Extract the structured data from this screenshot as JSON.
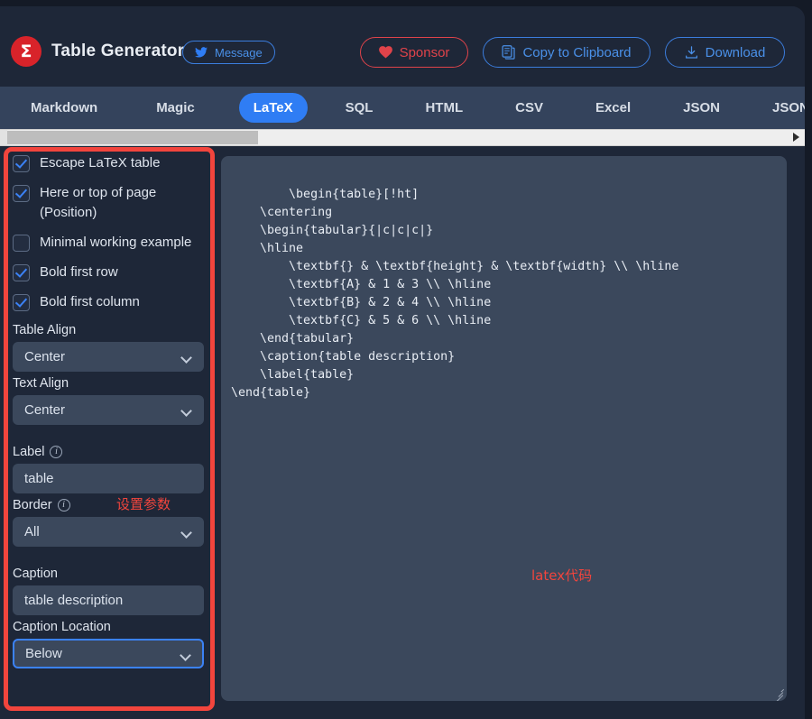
{
  "header": {
    "logo_glyph": "Σ",
    "title": "Table Generator",
    "message_button": "Message",
    "sponsor_button": "Sponsor",
    "copy_button": "Copy to Clipboard",
    "download_button": "Download",
    "colors": {
      "accent_blue": "#2f7df4",
      "accent_red": "#e0434a",
      "logo_red": "#d8232a"
    }
  },
  "tabs": {
    "active": "LaTeX",
    "items": [
      {
        "label": "Markdown"
      },
      {
        "label": "Magic"
      },
      {
        "label": "LaTeX"
      },
      {
        "label": "SQL"
      },
      {
        "label": "HTML"
      },
      {
        "label": "CSV"
      },
      {
        "label": "Excel"
      },
      {
        "label": "JSON"
      },
      {
        "label": "JSONLines"
      }
    ]
  },
  "sidebar": {
    "checkboxes": [
      {
        "label": "Escape LaTeX table",
        "checked": true
      },
      {
        "label": "Here or top of page (Position)",
        "checked": true
      },
      {
        "label": "Minimal working example",
        "checked": false
      },
      {
        "label": "Bold first row",
        "checked": true
      },
      {
        "label": "Bold first column",
        "checked": true
      }
    ],
    "fields": [
      {
        "label": "Table Align",
        "value": "Center",
        "type": "select",
        "focused": false,
        "info": false
      },
      {
        "label": "Text Align",
        "value": "Center",
        "type": "select",
        "focused": false,
        "info": false
      },
      {
        "label": "Label",
        "value": "table",
        "type": "text",
        "focused": false,
        "info": true
      },
      {
        "label": "Border",
        "value": "All",
        "type": "select",
        "focused": false,
        "info": true
      },
      {
        "label": "Caption",
        "value": "table description",
        "type": "text",
        "focused": false,
        "info": false
      },
      {
        "label": "Caption Location",
        "value": "Below",
        "type": "select",
        "focused": true,
        "info": false
      }
    ]
  },
  "code_panel": {
    "content": "\\begin{table}[!ht]\n    \\centering\n    \\begin{tabular}{|c|c|c|}\n    \\hline\n        \\textbf{} & \\textbf{height} & \\textbf{width} \\\\ \\hline\n        \\textbf{A} & 1 & 3 \\\\ \\hline\n        \\textbf{B} & 2 & 4 \\\\ \\hline\n        \\textbf{C} & 5 & 6 \\\\ \\hline\n    \\end{tabular}\n    \\caption{table description}\n    \\label{table}\n\\end{table}"
  },
  "annotations": {
    "params_note": "设置参数",
    "code_note": "latex代码",
    "color": "#f2453d"
  }
}
